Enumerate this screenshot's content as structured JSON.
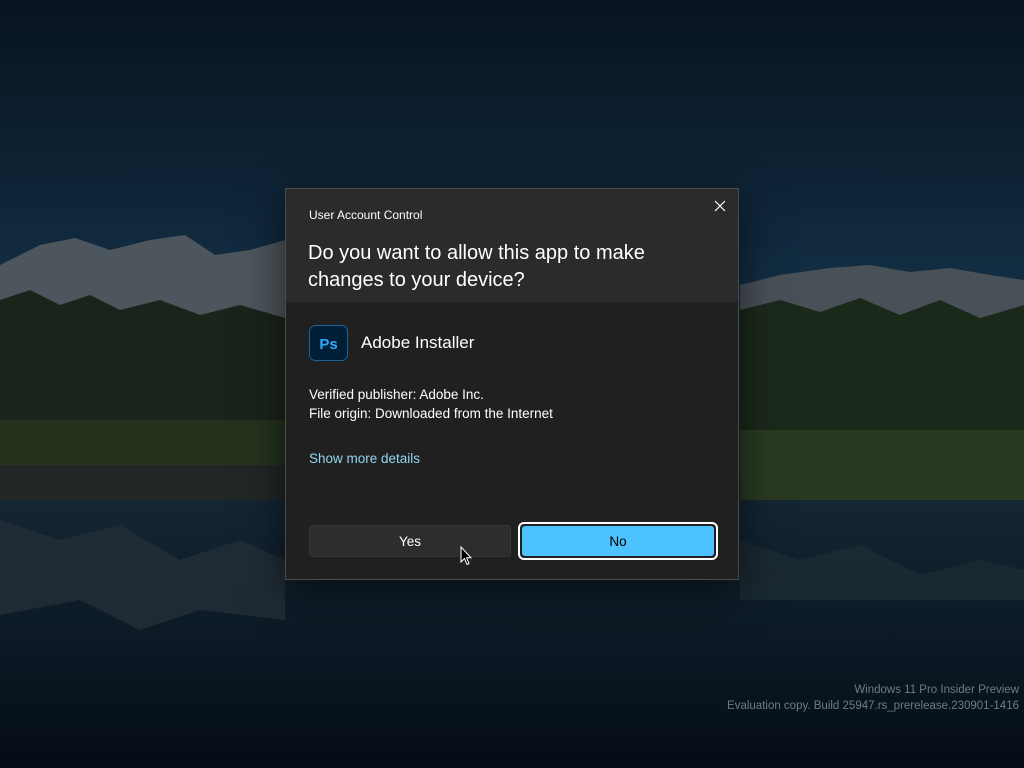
{
  "dialog": {
    "title": "User Account Control",
    "question": "Do you want to allow this app to make changes to your device?",
    "app_name": "Adobe Installer",
    "app_icon": "photoshop-icon",
    "app_icon_text": "Ps",
    "verified_publisher": "Verified publisher: Adobe Inc.",
    "file_origin": "File origin: Downloaded from the Internet",
    "details_link": "Show more details",
    "yes_label": "Yes",
    "no_label": "No",
    "close_icon": "close-icon"
  },
  "watermark": {
    "line1": "Windows 11 Pro Insider Preview",
    "line2": "Evaluation copy. Build 25947.rs_prerelease.230901-1416"
  },
  "colors": {
    "accent": "#4cc2ff",
    "link": "#8fd6f0",
    "dialog_bg": "#202020",
    "dialog_header_bg": "#2b2b2b"
  }
}
